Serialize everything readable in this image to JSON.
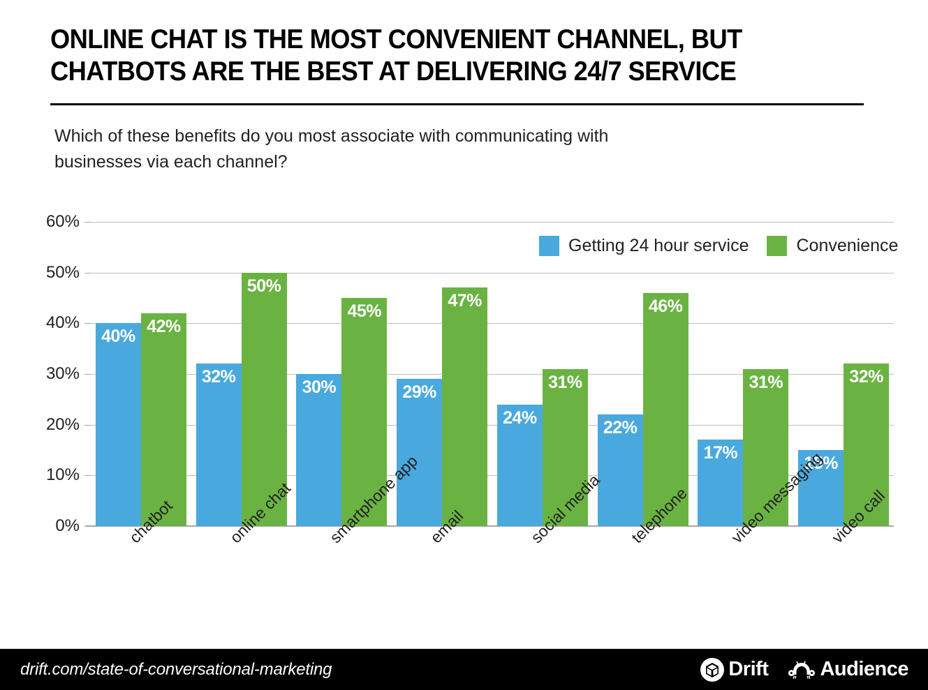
{
  "header": {
    "title": "ONLINE CHAT IS THE MOST CONVENIENT CHANNEL, BUT\nCHATBOTS ARE THE BEST AT DELIVERING 24/7 SERVICE",
    "subtitle": "Which of these benefits do you most associate with communicating with\nbusinesses via each channel?"
  },
  "footer": {
    "url": "drift.com/state-of-conversational-marketing",
    "logos": [
      {
        "name": "drift-logo",
        "label": "Drift",
        "icon": "drift-box-icon"
      },
      {
        "name": "audience-logo",
        "label": "Audience",
        "icon": "audience-robot-icon"
      }
    ]
  },
  "colors": {
    "series_0": "#49a9de",
    "series_1": "#6ab343",
    "text": "#231f20",
    "gridline": "#bfbfbf",
    "footer_bg": "#000000"
  },
  "chart_data": {
    "type": "bar",
    "title": "ONLINE CHAT IS THE MOST CONVENIENT CHANNEL, BUT CHATBOTS ARE THE BEST AT DELIVERING 24/7 SERVICE",
    "subtitle": "Which of these benefits do you most associate with communicating with businesses via each channel?",
    "xlabel": "",
    "ylabel": "",
    "ylim": [
      0,
      60
    ],
    "grid": true,
    "legend_position": "top-right",
    "categories": [
      "chatbot",
      "online chat",
      "smartphone app",
      "email",
      "social media",
      "telephone",
      "video messaging",
      "video call"
    ],
    "ytick_labels": [
      "0%",
      "10%",
      "20%",
      "30%",
      "40%",
      "50%",
      "60%"
    ],
    "ytick_values": [
      0,
      10,
      20,
      30,
      40,
      50,
      60
    ],
    "series": [
      {
        "name": "Getting 24 hour service",
        "color": "#49a9de",
        "values": [
          40,
          32,
          30,
          29,
          24,
          22,
          17,
          15
        ],
        "labels": [
          "40%",
          "32%",
          "30%",
          "29%",
          "24%",
          "22%",
          "17%",
          "15%"
        ]
      },
      {
        "name": "Convenience",
        "color": "#6ab343",
        "values": [
          42,
          50,
          45,
          47,
          31,
          46,
          31,
          32
        ],
        "labels": [
          "42%",
          "50%",
          "45%",
          "47%",
          "31%",
          "46%",
          "31%",
          "32%"
        ]
      }
    ]
  }
}
